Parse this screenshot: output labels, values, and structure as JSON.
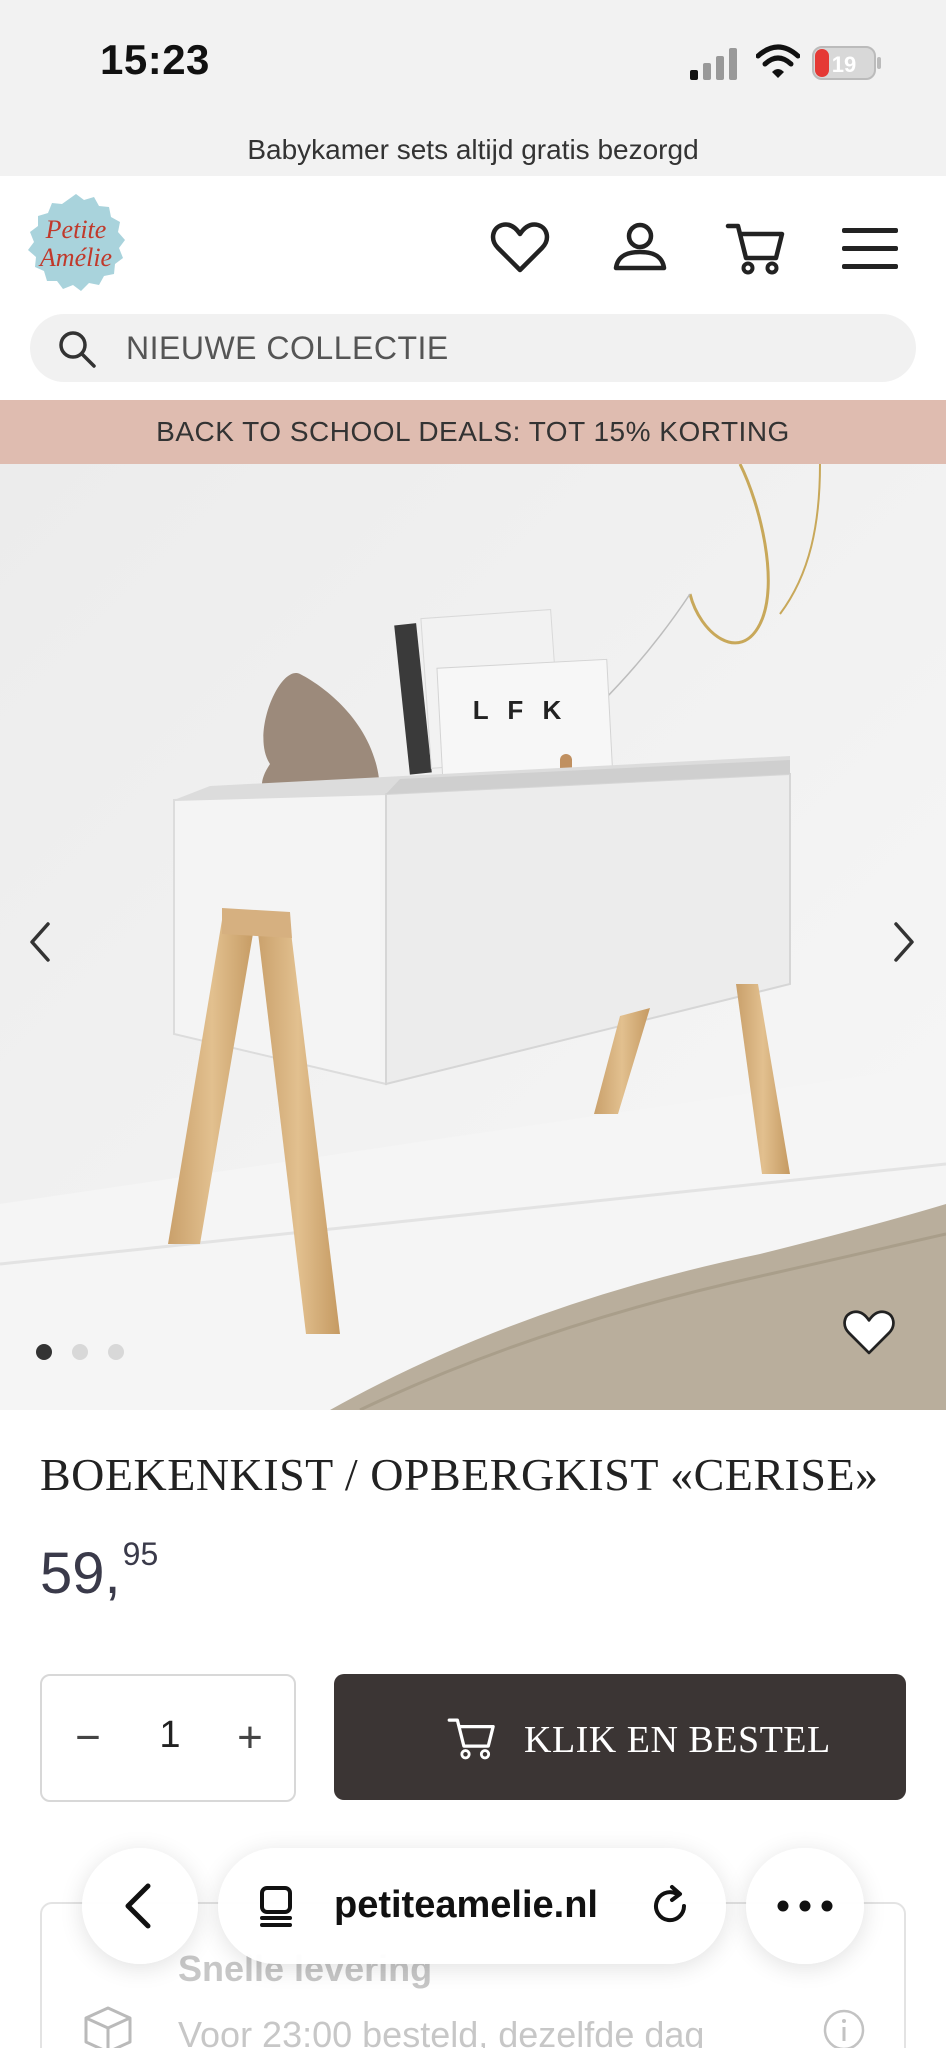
{
  "status_bar": {
    "time": "15:23",
    "battery": "19"
  },
  "announcement": "Babykamer sets altijd gratis bezorgd",
  "brand": {
    "logo_line1": "Petite",
    "logo_line2": "Amélie",
    "logo_bg": "#a9d3dc",
    "logo_text_color": "#c0392b"
  },
  "header": {
    "icons": [
      "heart-icon",
      "user-icon",
      "cart-icon",
      "menu-icon"
    ],
    "search_placeholder": "NIEUWE COLLECTIE"
  },
  "deals_banner": {
    "text": "BACK TO SCHOOL DEALS: TOT 15% KORTING",
    "bg": "#dfbcb0"
  },
  "gallery": {
    "book_cover_text": "L F K",
    "slide_count": 3,
    "active_slide": 1
  },
  "product": {
    "title": "BOEKENKIST / OPBERGKIST «CERISE»",
    "price_main": "59,",
    "price_cents": "95",
    "quantity": "1",
    "minus_label": "−",
    "plus_label": "+",
    "cta_label": "KLIK EN BESTEL",
    "cta_bg": "#3b3534"
  },
  "delivery": {
    "title": "Snelle levering",
    "subtitle": "Voor 23:00 besteld, dezelfde dag"
  },
  "browser": {
    "url": "petiteamelie.nl"
  }
}
